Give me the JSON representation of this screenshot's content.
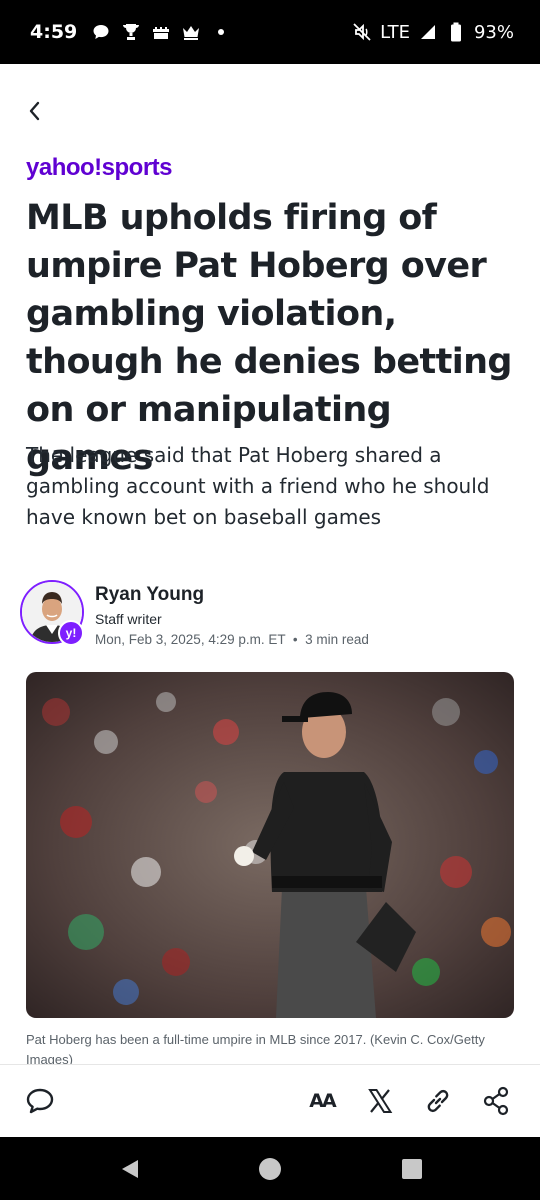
{
  "status_bar": {
    "time": "4:59",
    "network": "LTE",
    "battery": "93%",
    "icons": [
      "chat-bubble-icon",
      "trophy-icon",
      "castle-icon",
      "crown-icon",
      "dot-icon",
      "mute-icon",
      "signal-icon",
      "battery-icon"
    ]
  },
  "article": {
    "brand": "yahoo!sports",
    "headline": "MLB upholds firing of umpire Pat Hoberg over gambling violation, though he denies betting on or manipulating games",
    "subheadline": "The league said that Pat Hoberg shared a gambling account with a friend who he should have known bet on baseball games",
    "author": {
      "name": "Ryan Young",
      "role": "Staff writer",
      "date": "Mon, Feb 3, 2025, 4:29 p.m. ET",
      "read_time": "3 min read",
      "badge": "y!"
    },
    "image_caption": "Pat Hoberg has been a full-time umpire in MLB since 2017. (Kevin C. Cox/Getty Images)"
  },
  "toolbar": {
    "icons": [
      "comment-icon",
      "text-size-icon",
      "x-share-icon",
      "copy-link-icon",
      "share-icon"
    ],
    "text_size_label": "AA"
  },
  "colors": {
    "brand_purple": "#6001d2",
    "text_dark": "#1d2228",
    "meta_gray": "#5b636a"
  }
}
